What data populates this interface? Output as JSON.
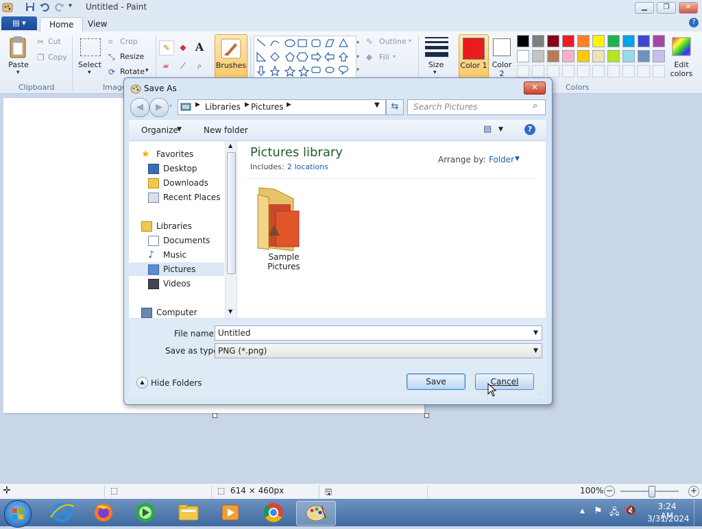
{
  "window": {
    "title": "Untitled - Paint"
  },
  "tabs": {
    "home": "Home",
    "view": "View"
  },
  "ribbon": {
    "clipboard": {
      "paste": "Paste",
      "cut": "Cut",
      "copy": "Copy",
      "label": "Clipboard"
    },
    "image": {
      "select": "Select",
      "crop": "Crop",
      "resize": "Resize",
      "rotate": "Rotate",
      "label": "Image"
    },
    "brushes": "Brushes",
    "shapes": {
      "outline": "Outline",
      "fill": "Fill"
    },
    "size": "Size",
    "color1": {
      "label": "Color 1",
      "color": "#e81c1c"
    },
    "color2": {
      "label": "Color 2",
      "color": "#ffffff"
    },
    "edit_colors": "Edit colors",
    "colors_label": "Colors",
    "palette_row1": [
      "#000000",
      "#7f7f7f",
      "#880015",
      "#ed1c24",
      "#ff7f27",
      "#fff200",
      "#22b14c",
      "#00a2e8",
      "#3f48cc",
      "#a349a4"
    ],
    "palette_row2": [
      "#ffffff",
      "#c3c3c3",
      "#b97a57",
      "#ffaec9",
      "#ffc90e",
      "#efe4b0",
      "#b5e61d",
      "#99d9ea",
      "#7092be",
      "#c8bfe7"
    ]
  },
  "dialog": {
    "title": "Save As",
    "address": [
      "Libraries",
      "Pictures"
    ],
    "search_placeholder": "Search Pictures",
    "organize": "Organize",
    "new_folder": "New folder",
    "nav": {
      "favorites": "Favorites",
      "desktop": "Desktop",
      "downloads": "Downloads",
      "recent": "Recent Places",
      "libraries": "Libraries",
      "documents": "Documents",
      "music": "Music",
      "pictures": "Pictures",
      "videos": "Videos",
      "computer": "Computer"
    },
    "library_title": "Pictures library",
    "includes_label": "Includes:",
    "includes_link": "2 locations",
    "arrange_label": "Arrange by:",
    "arrange_value": "Folder",
    "folder_name": "Sample Pictures",
    "file_name_label": "File name:",
    "file_name_value": "Untitled",
    "type_label": "Save as type:",
    "type_value": "PNG (*.png)",
    "hide_folders": "Hide Folders",
    "save": "Save",
    "cancel": "Cancel"
  },
  "status": {
    "dimensions": "614 × 460px",
    "zoom": "100%"
  },
  "clock": {
    "time": "3:24 AM",
    "date": "3/31/2024"
  }
}
